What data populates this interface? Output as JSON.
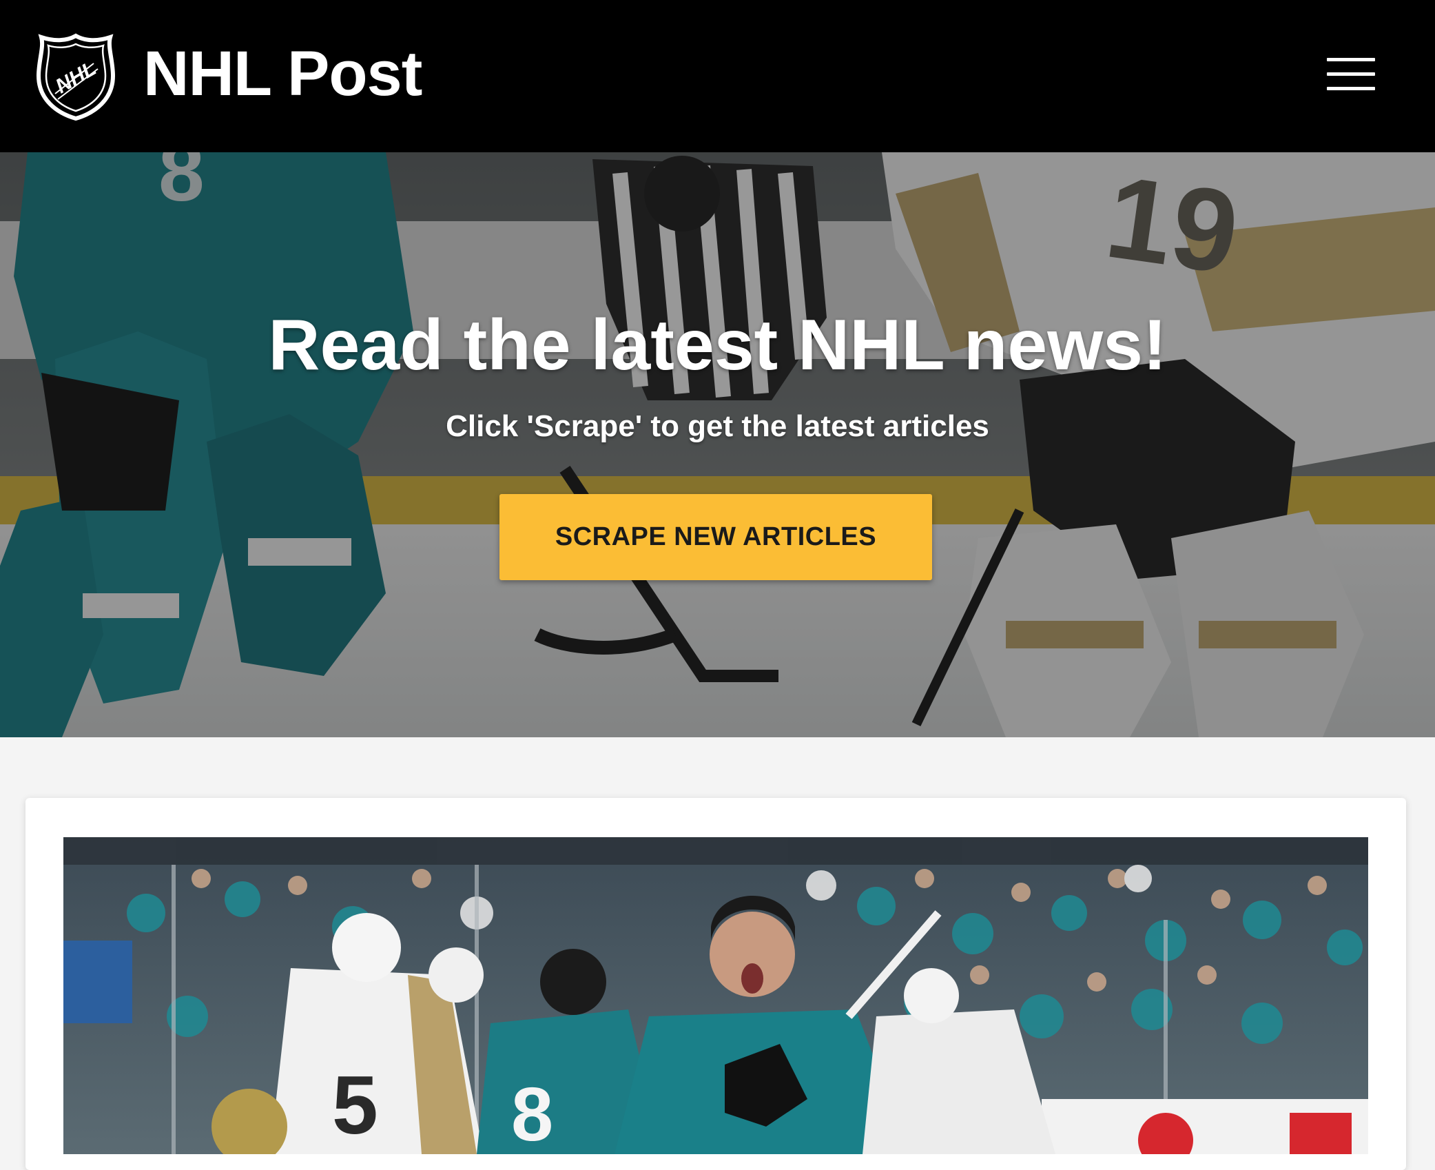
{
  "navbar": {
    "brand_title": "NHL Post",
    "logo_icon": "nhl-shield-logo",
    "menu_icon": "hamburger-menu-icon"
  },
  "hero": {
    "title": "Read the latest NHL news!",
    "subtitle": "Click 'Scrape' to get the latest articles",
    "button_label": "SCRAPE NEW ARTICLES"
  },
  "article": {
    "image_icon": "hockey-celebration-photo"
  },
  "colors": {
    "navbar_bg": "#000000",
    "accent_button": "#fbbd35",
    "page_bg": "#f4f4f4",
    "card_bg": "#ffffff",
    "sharks_teal": "#1f7f86",
    "knights_gold": "#b4975a"
  }
}
